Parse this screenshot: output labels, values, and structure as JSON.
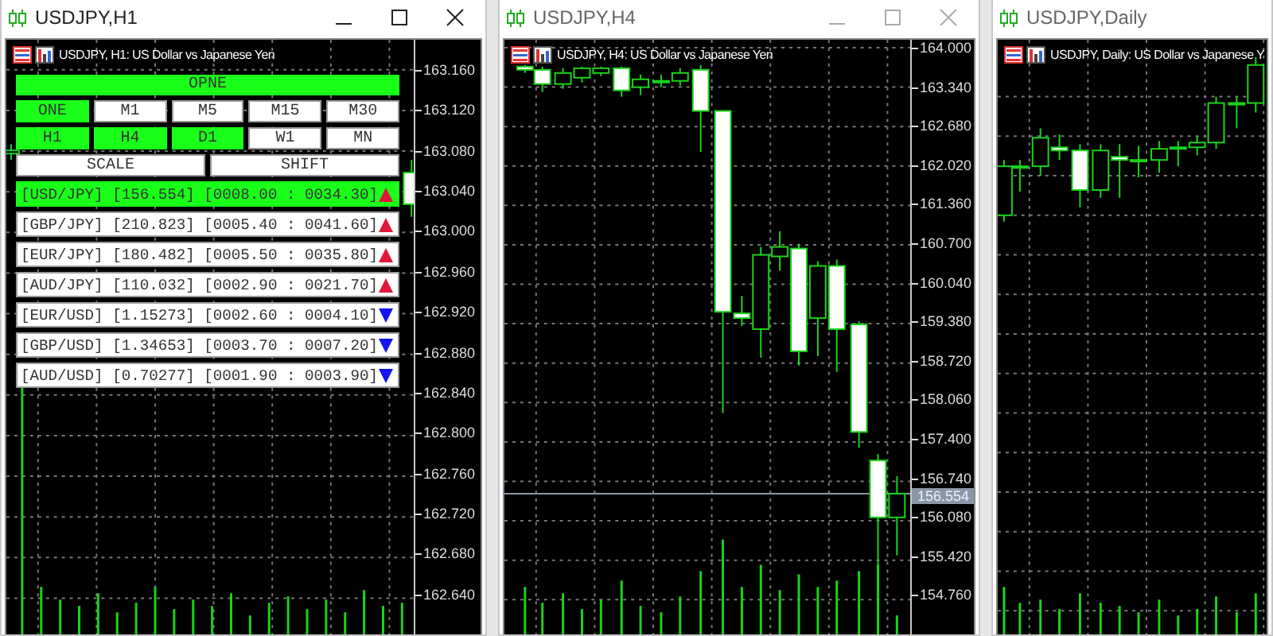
{
  "windows": [
    {
      "title": "USDJPY,H1",
      "active": true,
      "chart_label": "USDJPY, H1:  US Dollar vs Japanese Yen",
      "price_axis": [
        "163.160",
        "163.120",
        "163.080",
        "163.040",
        "163.000",
        "162.960",
        "162.920",
        "162.880",
        "162.840",
        "162.800",
        "162.760",
        "162.720",
        "162.680",
        "162.640"
      ],
      "panel": {
        "open_button": "OPNE",
        "timeframes": [
          {
            "label": "ONE",
            "selected": true
          },
          {
            "label": "M1",
            "selected": false
          },
          {
            "label": "M5",
            "selected": false
          },
          {
            "label": "M15",
            "selected": false
          },
          {
            "label": "M30",
            "selected": false
          },
          {
            "label": "H1",
            "selected": true
          },
          {
            "label": "H4",
            "selected": true
          },
          {
            "label": "D1",
            "selected": true
          },
          {
            "label": "W1",
            "selected": false
          },
          {
            "label": "MN",
            "selected": false
          }
        ],
        "actions": [
          "SCALE",
          "SHIFT"
        ],
        "pairs": [
          {
            "text": "[USD/JPY] [156.554] [0008.00 : 0034.30]",
            "selected": true,
            "kind": "up"
          },
          {
            "text": "[GBP/JPY] [210.823] [0005.40 : 0041.60]",
            "selected": false,
            "kind": "up"
          },
          {
            "text": "[EUR/JPY] [180.482] [0005.50 : 0035.80]",
            "selected": false,
            "kind": "up"
          },
          {
            "text": "[AUD/JPY] [110.032] [0002.90 : 0021.70]",
            "selected": false,
            "kind": "up"
          },
          {
            "text": "[EUR/USD] [1.15273] [0002.60 : 0004.10]",
            "selected": false,
            "kind": "down"
          },
          {
            "text": "[GBP/USD] [1.34653] [0003.70 : 0007.20]",
            "selected": false,
            "kind": "down"
          },
          {
            "text": "[AUD/USD] [0.70277] [0001.90 : 0003.90]",
            "selected": false,
            "kind": "down"
          }
        ]
      }
    },
    {
      "title": "USDJPY,H4",
      "active": false,
      "chart_label": "USDJPY, H4:  US Dollar vs Japanese Yen",
      "price_axis": [
        "164.000",
        "163.340",
        "162.680",
        "162.020",
        "161.360",
        "160.700",
        "160.040",
        "159.380",
        "158.720",
        "158.060",
        "157.400",
        "156.740",
        "156.080",
        "155.420",
        "154.760"
      ],
      "price_tag": "156.554"
    },
    {
      "title": "USDJPY,Daily",
      "active": false,
      "chart_label": "USDJPY, Daily:  US Dollar vs Japanese Y"
    }
  ]
}
